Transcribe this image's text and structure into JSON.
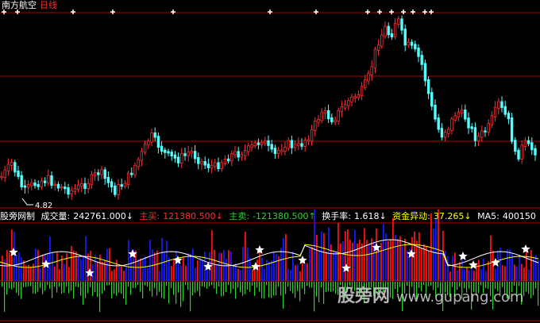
{
  "header": {
    "stock_name": "南方航空",
    "period": "日线"
  },
  "price_panel": {
    "low_label": "4.82"
  },
  "indicator_bar": {
    "name": "股旁网制",
    "volume_label": "成交量:",
    "volume_value": "242761.000↓",
    "buy_label": "主买:",
    "buy_value": "121380.500↓",
    "sell_label": "主卖:",
    "sell_value": "-121380.500↑",
    "turnover_label": "换手率:",
    "turnover_value": "1.618↓",
    "fund_label": "资金异动:",
    "fund_value": "37.265↓",
    "ma5_label": "MA5:",
    "ma5_value": "400150"
  },
  "watermark": {
    "text": "股旁网",
    "url": "www.gupang.com"
  },
  "colors": {
    "up": "#ff3232",
    "down": "#54ffff",
    "grid": "#b00000",
    "buy": "#1818ff",
    "sell": "#ff1010",
    "green": "#30d030",
    "yellow": "#ffff00",
    "white": "#ffffff"
  }
}
